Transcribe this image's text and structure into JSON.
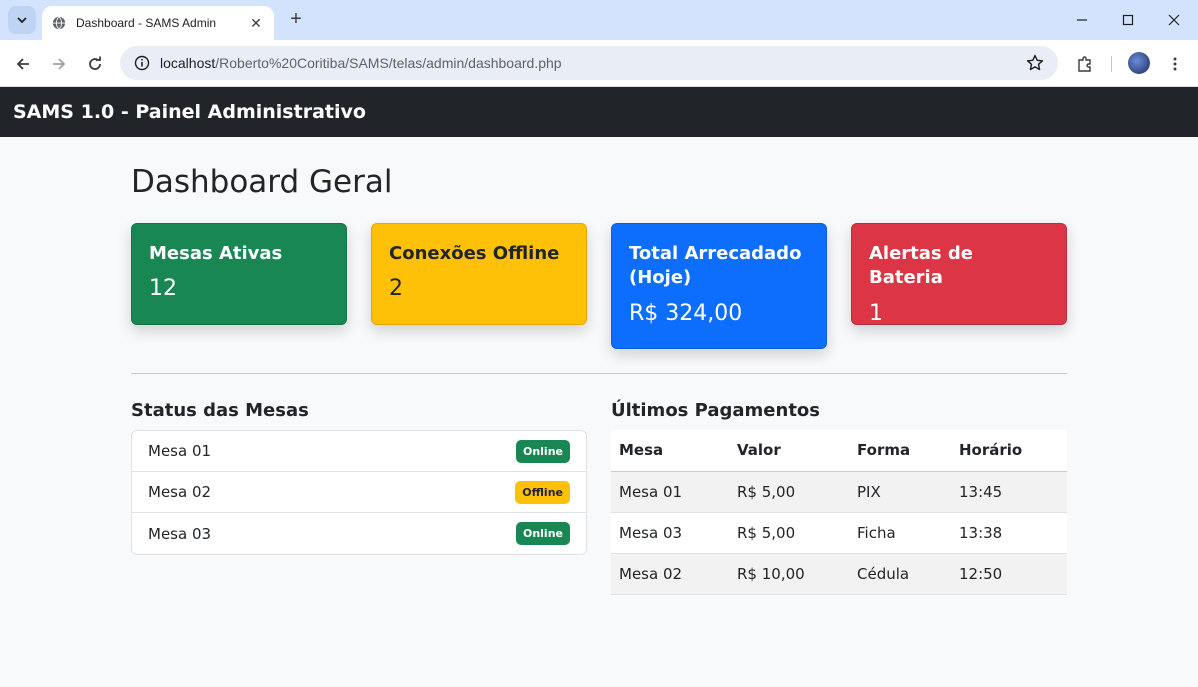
{
  "browser": {
    "tab_title": "Dashboard - SAMS Admin",
    "url_host": "localhost",
    "url_path": "/Roberto%20Coritiba/SAMS/telas/admin/dashboard.php"
  },
  "app": {
    "brand": "SAMS 1.0 - Painel Administrativo"
  },
  "page": {
    "title": "Dashboard Geral"
  },
  "cards": [
    {
      "title": "Mesas Ativas",
      "value": "12",
      "color": "#198754"
    },
    {
      "title": "Conexões Offline",
      "value": "2",
      "color": "#ffc107"
    },
    {
      "title": "Total Arrecadado (Hoje)",
      "value": "R$ 324,00",
      "color": "#0d6efd"
    },
    {
      "title": "Alertas de Bateria",
      "value": "1",
      "color": "#dc3545"
    }
  ],
  "status": {
    "title": "Status das Mesas",
    "items": [
      {
        "name": "Mesa 01",
        "badge": "Online"
      },
      {
        "name": "Mesa 02",
        "badge": "Offline"
      },
      {
        "name": "Mesa 03",
        "badge": "Online"
      }
    ]
  },
  "payments": {
    "title": "Últimos Pagamentos",
    "headers": [
      "Mesa",
      "Valor",
      "Forma",
      "Horário"
    ],
    "rows": [
      [
        "Mesa 01",
        "R$ 5,00",
        "PIX",
        "13:45"
      ],
      [
        "Mesa 03",
        "R$ 5,00",
        "Ficha",
        "13:38"
      ],
      [
        "Mesa 02",
        "R$ 10,00",
        "Cédula",
        "12:50"
      ]
    ]
  }
}
